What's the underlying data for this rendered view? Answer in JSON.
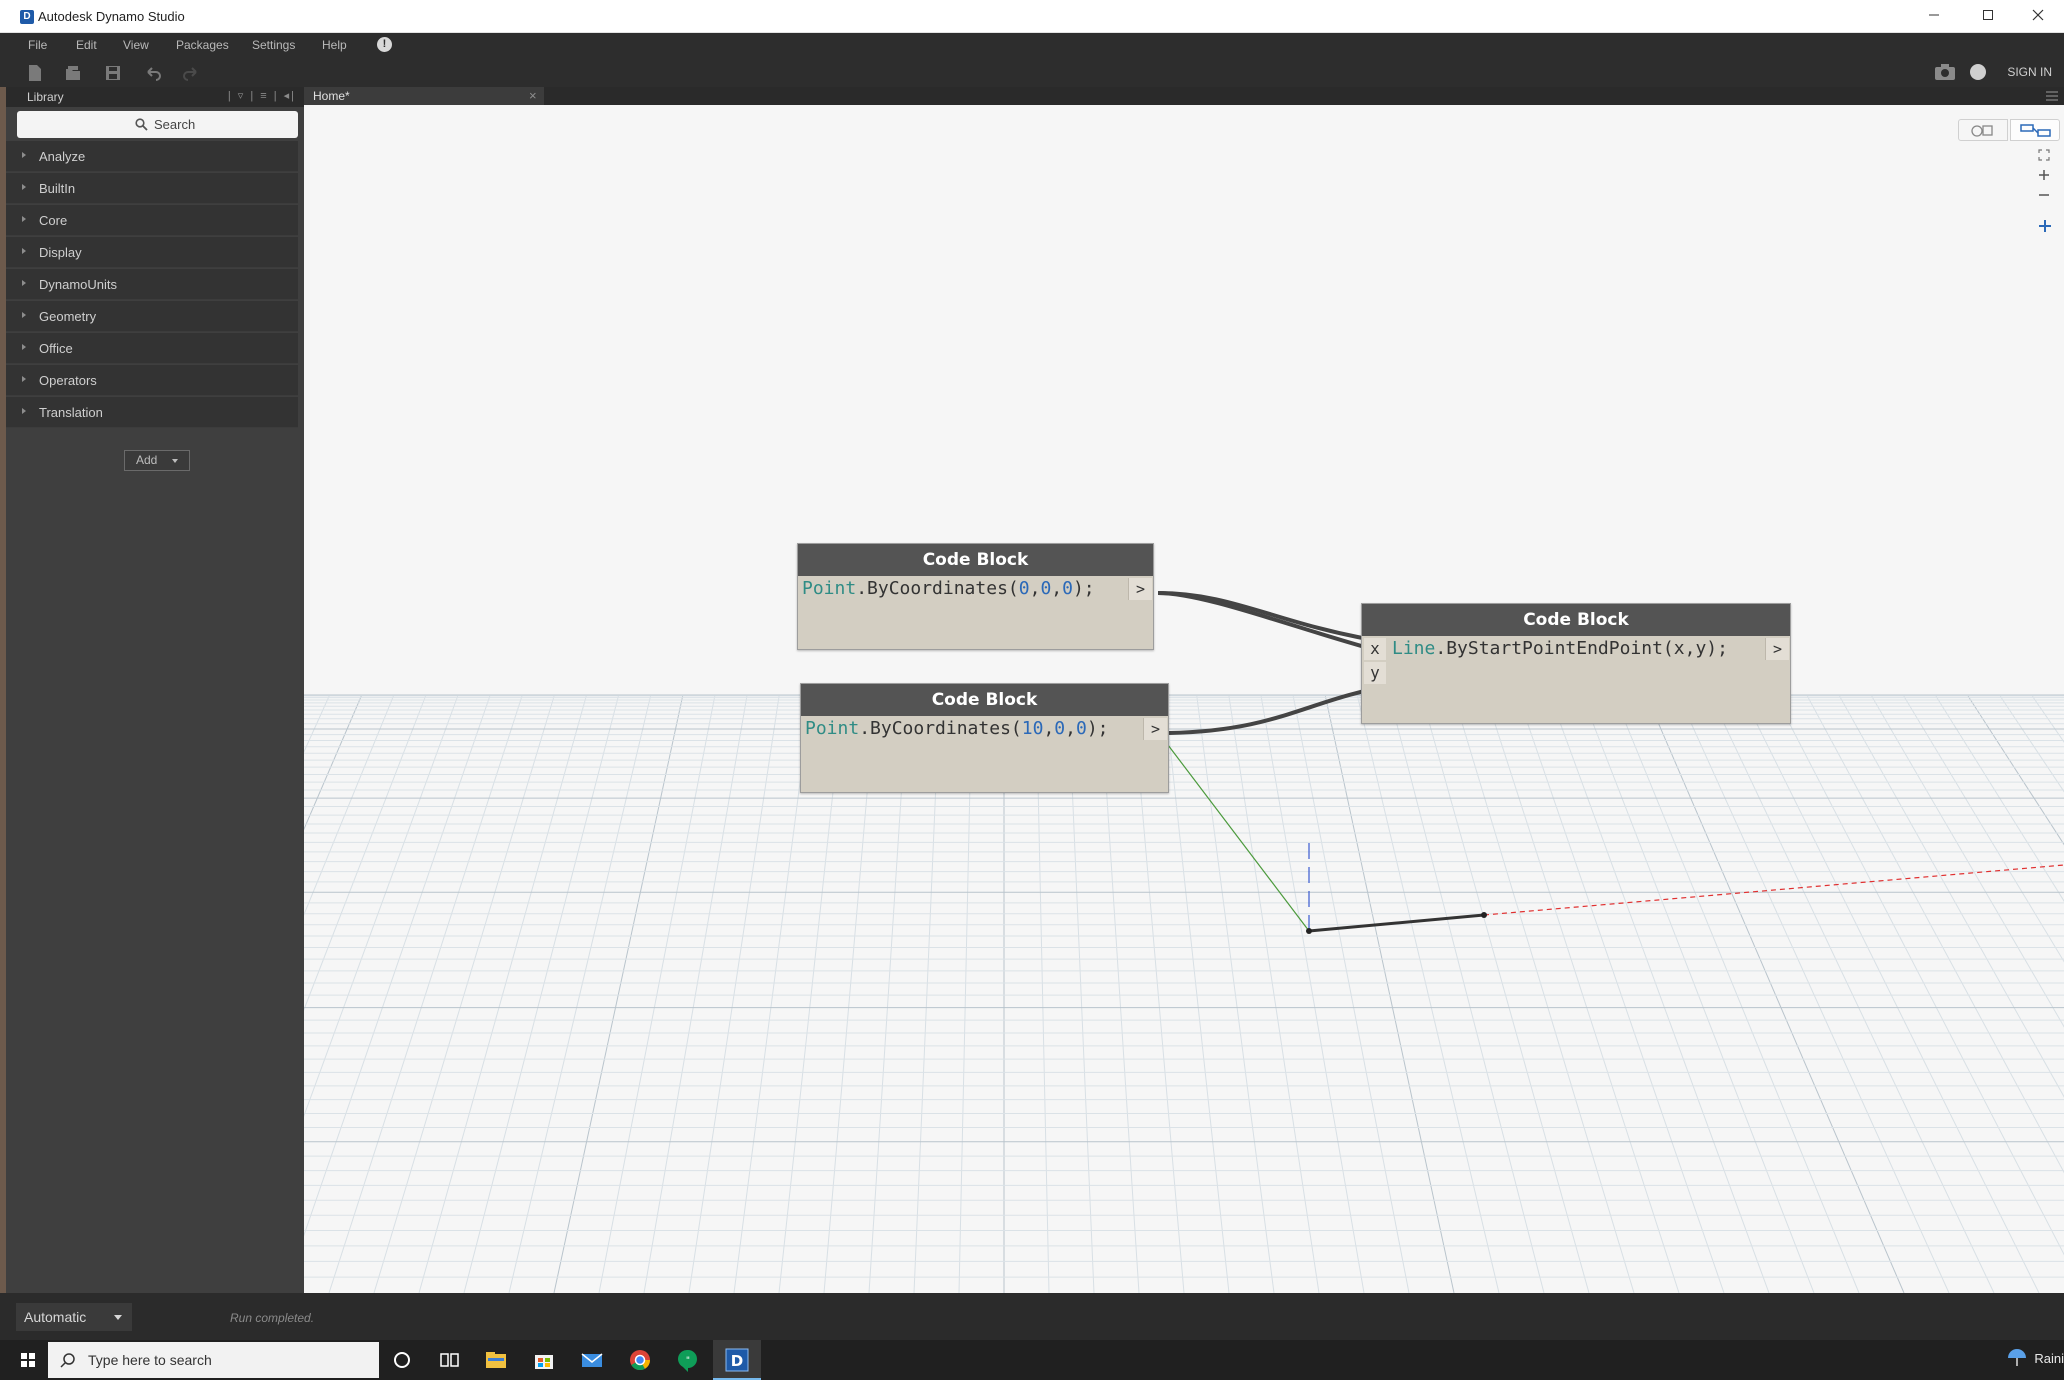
{
  "window": {
    "title": "Autodesk Dynamo Studio",
    "icon_letter": "D"
  },
  "menu": [
    "File",
    "Edit",
    "View",
    "Packages",
    "Settings",
    "Help"
  ],
  "toolbar": {
    "sign_in": "SIGN IN"
  },
  "library": {
    "title": "Library",
    "search_placeholder": "Search",
    "categories": [
      "Analyze",
      "BuiltIn",
      "Core",
      "Display",
      "DynamoUnits",
      "Geometry",
      "Office",
      "Operators",
      "Translation"
    ],
    "add_label": "Add"
  },
  "tab": {
    "label": "Home*",
    "close": "×"
  },
  "nodes": [
    {
      "title": "Code Block",
      "code_ident": "Point",
      "code_rest": ".ByCoordinates(",
      "args": [
        "0",
        "0",
        "0"
      ],
      "code_tail": ");",
      "out_port": ">"
    },
    {
      "title": "Code Block",
      "code_ident": "Point",
      "code_rest": ".ByCoordinates(",
      "args": [
        "10",
        "0",
        "0"
      ],
      "code_tail": ");",
      "out_port": ">"
    },
    {
      "title": "Code Block",
      "code_ident": "Line",
      "code_rest": ".ByStartPointEndPoint(x,y);",
      "out_port": ">",
      "in_ports": [
        "x",
        "y"
      ]
    }
  ],
  "status": {
    "run_mode": "Automatic",
    "message": "Run completed."
  },
  "taskbar": {
    "search_placeholder": "Type here to search",
    "weather": "Raini"
  },
  "colors": {
    "accent": "#2b69b8",
    "ident": "#2f8c85",
    "node_header": "#545454",
    "node_body": "#d3cec2"
  }
}
